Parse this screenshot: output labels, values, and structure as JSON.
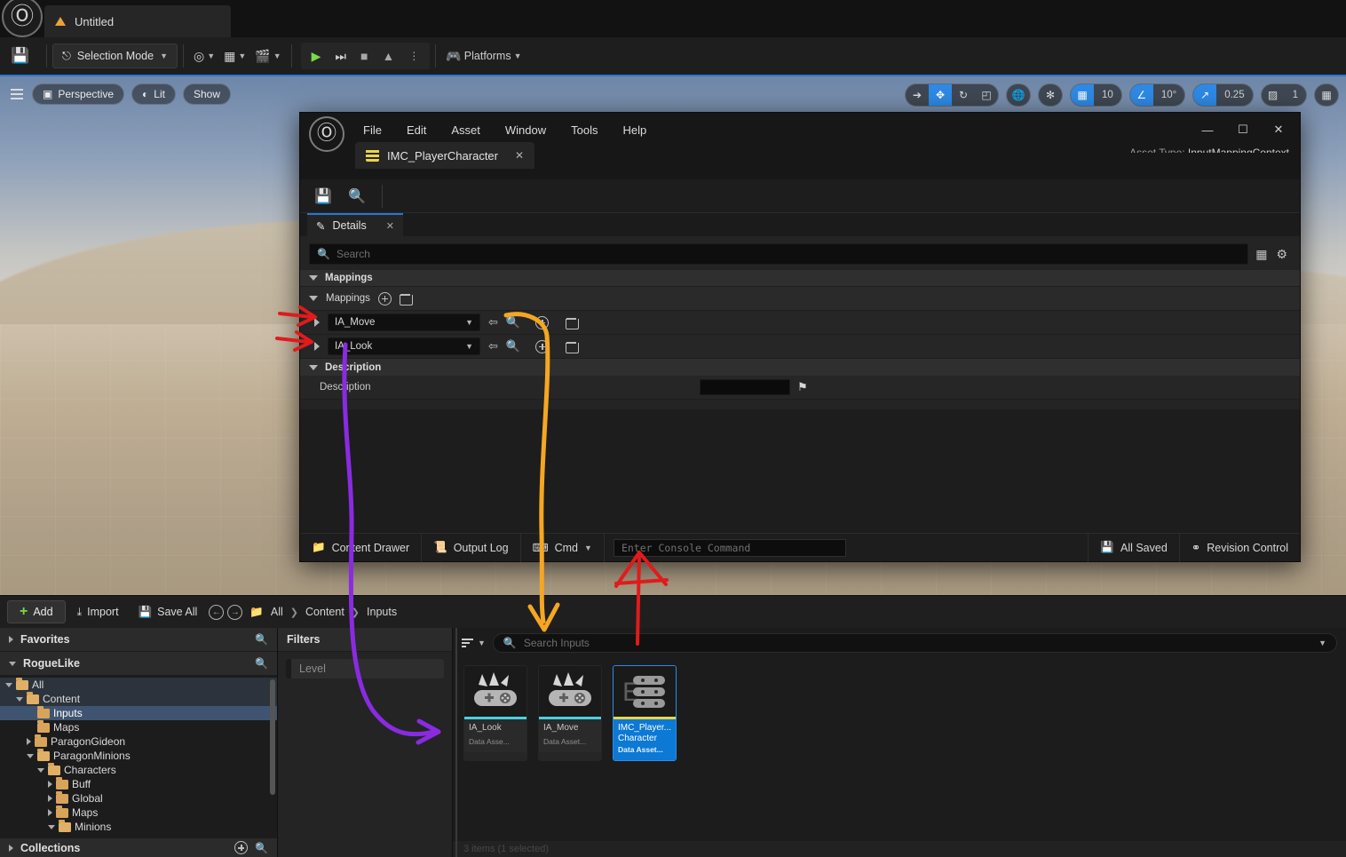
{
  "appbar": {
    "logo_icon": "unreal-logo-icon",
    "tab_label": "Untitled",
    "tab_icon": "level-warning-icon"
  },
  "toolbar": {
    "save_icon": "save-icon",
    "selection_mode_label": "Selection Mode",
    "add_icon": "add-actor-icon",
    "blueprints_icon": "blueprints-icon",
    "cinematics_icon": "cinematics-icon",
    "play_icon": "play-icon",
    "skip_icon": "skip-icon",
    "stop_icon": "stop-icon",
    "eject_icon": "eject-icon",
    "more_icon": "more-options-icon",
    "platforms_label": "Platforms",
    "platforms_icon": "platforms-icon"
  },
  "viewport": {
    "menu_icon": "viewport-menu-icon",
    "perspective_label": "Perspective",
    "perspective_icon": "cube-icon",
    "lit_label": "Lit",
    "lit_icon": "lighting-icon",
    "show_label": "Show",
    "transform_tools": [
      {
        "icon": "select-cursor-icon",
        "active": false
      },
      {
        "icon": "move-gizmo-icon",
        "active": true
      },
      {
        "icon": "rotate-gizmo-icon",
        "active": false
      },
      {
        "icon": "scale-gizmo-icon",
        "active": false
      }
    ],
    "coord_icon": "world-coordinate-icon",
    "surface_snap_icon": "surface-snap-icon",
    "grid_snap": {
      "icon": "grid-snap-icon",
      "value": "10",
      "active": true
    },
    "angle_snap": {
      "icon": "angle-snap-icon",
      "value": "10°",
      "active": true
    },
    "scale_snap": {
      "icon": "scale-snap-icon",
      "value": "0.25",
      "active": true
    },
    "camera_speed": {
      "icon": "camera-icon",
      "value": "1"
    },
    "layout_icon": "viewport-layout-icon"
  },
  "editor": {
    "logo_icon": "unreal-logo-icon",
    "menu": [
      "File",
      "Edit",
      "Asset",
      "Window",
      "Tools",
      "Help"
    ],
    "window_buttons": {
      "minimize": "—",
      "maximize": "☐",
      "close": "✕"
    },
    "asset_type_label": "Asset Type:",
    "asset_type_value": "InputMappingContext",
    "tab": {
      "label": "IMC_PlayerCharacter",
      "icon": "input-mapping-context-icon",
      "close": "✕"
    },
    "toolbar_icons": [
      "save-icon",
      "browse-content-icon"
    ],
    "details": {
      "tab_label": "Details",
      "tab_icon": "details-pencil-icon",
      "tab_close": "✕",
      "search_placeholder": "Search",
      "search_icon": "search-icon",
      "grid_view_icon": "column-view-icon",
      "settings_icon": "gear-icon",
      "category_label": "Mappings",
      "array_label": "Mappings",
      "array_add_icon": "add-element-icon",
      "array_clear_icon": "delete-all-icon",
      "rows": [
        {
          "value": "IA_Move",
          "expand_icon": "expand-arrow-icon",
          "reset_icon": "reset-to-default-icon",
          "browse_icon": "browse-asset-icon",
          "add_icon": "insert-element-icon",
          "delete_icon": "delete-element-icon"
        },
        {
          "value": "IA_Look",
          "expand_icon": "expand-arrow-icon",
          "reset_icon": "reset-to-default-icon",
          "browse_icon": "browse-asset-icon",
          "add_icon": "insert-element-icon",
          "delete_icon": "delete-element-icon"
        }
      ],
      "description_category": "Description",
      "description_label": "Description",
      "description_value": "",
      "description_flag_icon": "localization-flag-icon"
    },
    "status": {
      "content_drawer_label": "Content Drawer",
      "content_drawer_icon": "content-drawer-icon",
      "output_log_label": "Output Log",
      "output_log_icon": "output-log-icon",
      "cmd_label": "Cmd",
      "cmd_icon": "console-icon",
      "console_placeholder": "Enter Console Command",
      "all_saved_label": "All Saved",
      "all_saved_icon": "save-check-icon",
      "revision_control_label": "Revision Control",
      "revision_control_icon": "source-control-icon"
    }
  },
  "content_browser": {
    "add_label": "Add",
    "import_label": "Import",
    "import_icon": "import-icon",
    "save_all_label": "Save All",
    "save_all_icon": "save-icon",
    "back_icon": "back-arrow-icon",
    "forward_icon": "forward-arrow-icon",
    "path_icon": "folder-icon",
    "breadcrumbs": [
      "All",
      "Content",
      "Inputs"
    ],
    "favorites_label": "Favorites",
    "favorites_search_icon": "search-icon",
    "project_label": "RogueLike",
    "project_search_icon": "search-icon",
    "collections_label": "Collections",
    "collections_add_icon": "add-icon",
    "collections_search_icon": "search-icon",
    "tree": [
      {
        "label": "All",
        "depth": 0,
        "state": "expanded",
        "folder": "open",
        "highlight": true
      },
      {
        "label": "Content",
        "depth": 1,
        "state": "expanded",
        "folder": "open",
        "highlight": true
      },
      {
        "label": "Inputs",
        "depth": 2,
        "state": "leaf",
        "folder": "closed",
        "selected": true
      },
      {
        "label": "Maps",
        "depth": 2,
        "state": "leaf",
        "folder": "closed"
      },
      {
        "label": "ParagonGideon",
        "depth": 2,
        "state": "collapsed",
        "folder": "closed"
      },
      {
        "label": "ParagonMinions",
        "depth": 2,
        "state": "expanded",
        "folder": "open"
      },
      {
        "label": "Characters",
        "depth": 3,
        "state": "expanded",
        "folder": "open"
      },
      {
        "label": "Buff",
        "depth": 4,
        "state": "collapsed",
        "folder": "closed"
      },
      {
        "label": "Global",
        "depth": 4,
        "state": "collapsed",
        "folder": "closed"
      },
      {
        "label": "Maps",
        "depth": 4,
        "state": "collapsed",
        "folder": "closed"
      },
      {
        "label": "Minions",
        "depth": 4,
        "state": "expanded",
        "folder": "open"
      }
    ],
    "filters_label": "Filters",
    "filter_placeholder": "Level",
    "filter_dropdown_icon": "filter-icon",
    "search_placeholder": "Search Inputs",
    "search_icon": "search-icon",
    "search_dropdown_icon": "chevron-down-icon",
    "assets": [
      {
        "name": "IA_Look",
        "type": "Data Asse...",
        "icon": "input-action-icon",
        "selected": false
      },
      {
        "name": "IA_Move",
        "type": "Data Asset...",
        "icon": "input-action-icon",
        "selected": false
      },
      {
        "name": "IMC_Player...",
        "name2": "Character",
        "type": "Data Asset...",
        "icon": "input-mapping-context-icon",
        "selected": true
      }
    ],
    "status_text": "3 items (1 selected)"
  },
  "annotations": {
    "red_color": "#e01b1b",
    "orange_color": "#f5a623",
    "purple_color": "#8a2be2",
    "notes": [
      {
        "color": "#e01b1b",
        "shape": "arrow-pointing-right",
        "target": "mapping-row-ia-move"
      },
      {
        "color": "#e01b1b",
        "shape": "arrow-pointing-right",
        "target": "mapping-row-ia-look"
      },
      {
        "color": "#f5a623",
        "shape": "curved-arrow-down",
        "target": "content-browser-search"
      },
      {
        "color": "#8a2be2",
        "shape": "curved-arrow-down-right",
        "target": "filters-panel"
      },
      {
        "color": "#e01b1b",
        "shape": "arrow-pointing-up",
        "target": "console-command-area"
      }
    ]
  }
}
